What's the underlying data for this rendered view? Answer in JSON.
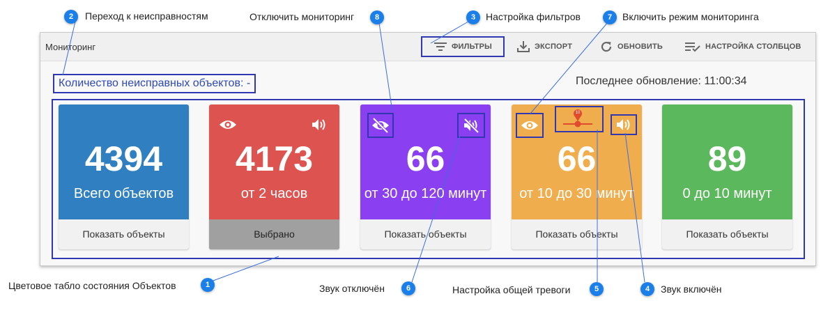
{
  "toolbar": {
    "title": "Мониторинг",
    "filters_label": "ФИЛЬТРЫ",
    "export_label": "ЭКСПОРТ",
    "refresh_label": "ОБНОВИТЬ",
    "columns_label": "НАСТРОЙКА СТОЛБЦОВ"
  },
  "summary": {
    "broken_count": "Количество неисправных объектов: -",
    "last_update": "Последнее обновление: 11:00:34"
  },
  "cards": [
    {
      "value": "4394",
      "label": "Всего объектов",
      "footer": "Показать объекты",
      "color": "#2f7fc1"
    },
    {
      "value": "4173",
      "label": "от 2 часов",
      "footer": "Выбрано",
      "color": "#dc5350"
    },
    {
      "value": "66",
      "label": "от 30 до 120 минут",
      "footer": "Показать объекты",
      "color": "#8a3ff0"
    },
    {
      "value": "66",
      "label": "от 10 до 30 минут",
      "footer": "Показать объекты",
      "color": "#f0ad4e"
    },
    {
      "value": "89",
      "label": "0 до 10 минут",
      "footer": "Показать объекты",
      "color": "#5cb85c"
    }
  ],
  "alarm": {
    "badge": "10"
  },
  "callouts": [
    {
      "num": "1",
      "text": "Цветовое табло состояния Объектов"
    },
    {
      "num": "2",
      "text": "Переход к неисправностям"
    },
    {
      "num": "3",
      "text": "Настройка фильтров"
    },
    {
      "num": "4",
      "text": "Звук включён"
    },
    {
      "num": "5",
      "text": "Настройка общей тревоги"
    },
    {
      "num": "6",
      "text": "Звук отключён"
    },
    {
      "num": "7",
      "text": "Включить режим мониторинга"
    },
    {
      "num": "8",
      "text": "Отключить мониторинг"
    }
  ]
}
